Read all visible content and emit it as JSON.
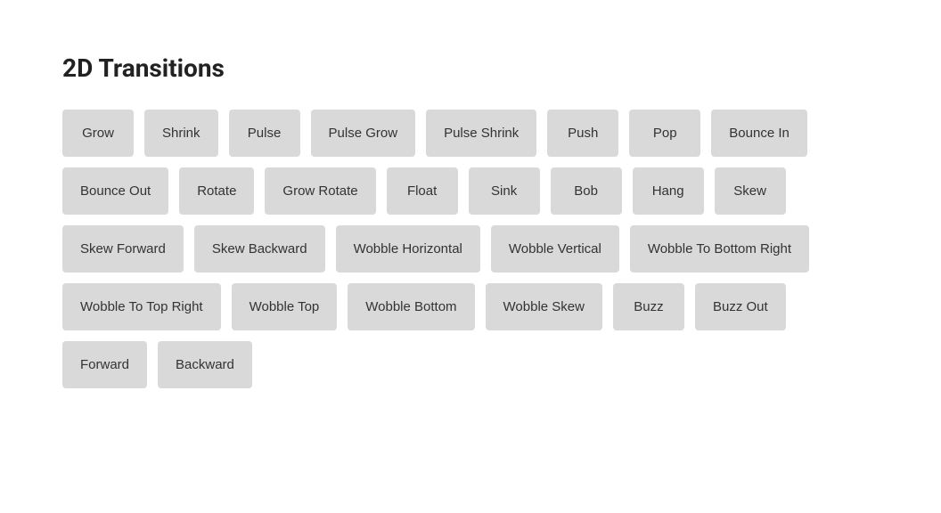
{
  "page": {
    "title": "2D Transitions",
    "buttons": [
      {
        "label": "Grow"
      },
      {
        "label": "Shrink"
      },
      {
        "label": "Pulse"
      },
      {
        "label": "Pulse Grow"
      },
      {
        "label": "Pulse Shrink"
      },
      {
        "label": "Push"
      },
      {
        "label": "Pop"
      },
      {
        "label": "Bounce In"
      },
      {
        "label": "Bounce Out"
      },
      {
        "label": "Rotate"
      },
      {
        "label": "Grow Rotate"
      },
      {
        "label": "Float"
      },
      {
        "label": "Sink"
      },
      {
        "label": "Bob"
      },
      {
        "label": "Hang"
      },
      {
        "label": "Skew"
      },
      {
        "label": "Skew Forward"
      },
      {
        "label": "Skew Backward"
      },
      {
        "label": "Wobble Horizontal"
      },
      {
        "label": "Wobble Vertical"
      },
      {
        "label": "Wobble To Bottom Right"
      },
      {
        "label": "Wobble To Top Right"
      },
      {
        "label": "Wobble Top"
      },
      {
        "label": "Wobble Bottom"
      },
      {
        "label": "Wobble Skew"
      },
      {
        "label": "Buzz"
      },
      {
        "label": "Buzz Out"
      },
      {
        "label": "Forward"
      },
      {
        "label": "Backward"
      }
    ]
  }
}
